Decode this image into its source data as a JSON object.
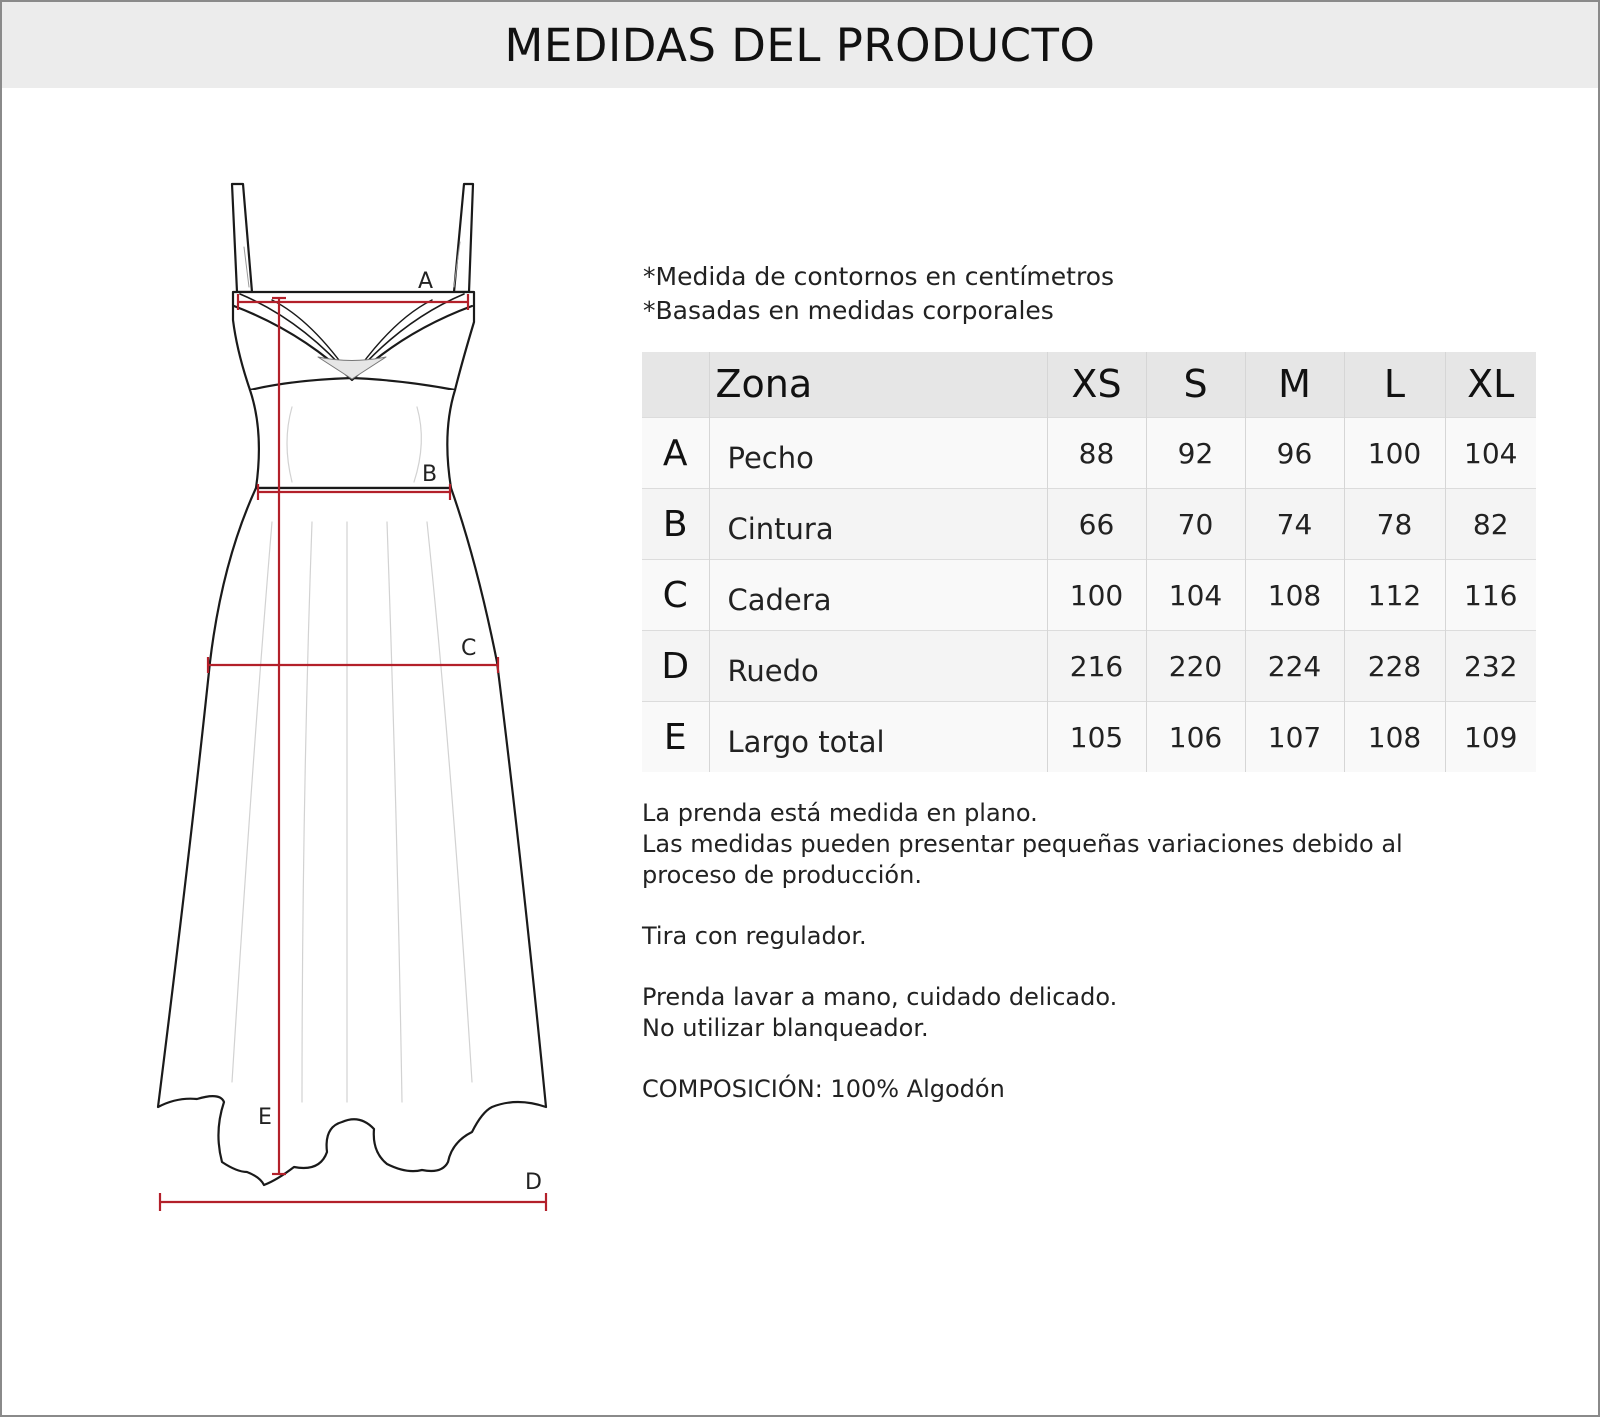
{
  "header": {
    "title": "MEDIDAS DEL PRODUCTO"
  },
  "sketch": {
    "labels": {
      "a": "A",
      "b": "B",
      "c": "C",
      "d": "D",
      "e": "E"
    }
  },
  "notes_top": [
    "*Medida de contornos en centímetros",
    "*Basadas en medidas corporales"
  ],
  "table": {
    "zona_header": "Zona",
    "sizes": [
      "XS",
      "S",
      "M",
      "L",
      "XL"
    ],
    "rows": [
      {
        "letter": "A",
        "zone": "Pecho",
        "values": [
          "88",
          "92",
          "96",
          "100",
          "104"
        ]
      },
      {
        "letter": "B",
        "zone": "Cintura",
        "values": [
          "66",
          "70",
          "74",
          "78",
          "82"
        ]
      },
      {
        "letter": "C",
        "zone": "Cadera",
        "values": [
          "100",
          "104",
          "108",
          "112",
          "116"
        ]
      },
      {
        "letter": "D",
        "zone": "Ruedo",
        "values": [
          "216",
          "220",
          "224",
          "228",
          "232"
        ]
      },
      {
        "letter": "E",
        "zone": "Largo total",
        "values": [
          "105",
          "106",
          "107",
          "108",
          "109"
        ]
      }
    ]
  },
  "notes_bottom": {
    "measure": [
      "La prenda está medida en plano.",
      "Las medidas pueden presentar pequeñas variaciones debido al",
      "proceso de producción."
    ],
    "strap": "Tira con regulador.",
    "care": [
      "Prenda lavar a mano, cuidado delicado.",
      "No utilizar blanqueador."
    ],
    "composition": "COMPOSICIÓN: 100% Algodón"
  },
  "colors": {
    "header_bg": "#ececec",
    "measure_line": "#b3202a",
    "outline": "#1a1a1a",
    "table_header_bg": "#e6e6e6"
  }
}
